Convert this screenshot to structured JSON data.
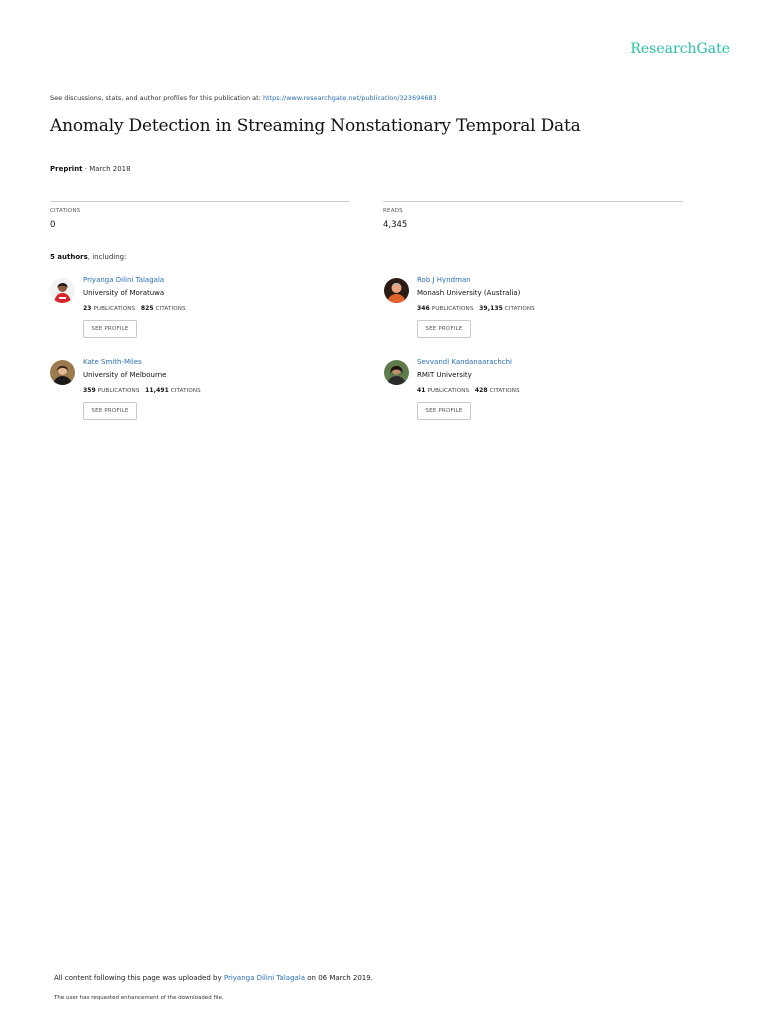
{
  "brand": "ResearchGate",
  "discussion": {
    "text": "See discussions, stats, and author profiles for this publication at: ",
    "url": "https://www.researchgate.net/publication/323694683"
  },
  "title": "Anomaly Detection in Streaming Nonstationary Temporal Data",
  "meta": {
    "type": "Preprint",
    "date": " · March 2018"
  },
  "stats": {
    "citations_label": "CITATIONS",
    "citations": "0",
    "reads_label": "READS",
    "reads": "4,345"
  },
  "authors_heading": {
    "count": "5 authors",
    "suffix": ", including:"
  },
  "authors": [
    {
      "name": "Priyanga Dilini Talagala",
      "institution": "University of Moratuwa",
      "publications": "23",
      "pub_label": "PUBLICATIONS",
      "citations": "825",
      "cit_label": "CITATIONS",
      "button": "SEE PROFILE"
    },
    {
      "name": "Rob J Hyndman",
      "institution": "Monash University (Australia)",
      "publications": "346",
      "pub_label": "PUBLICATIONS",
      "citations": "39,135",
      "cit_label": "CITATIONS",
      "button": "SEE PROFILE"
    },
    {
      "name": "Kate Smith-Miles",
      "institution": "University of Melbourne",
      "publications": "359",
      "pub_label": "PUBLICATIONS",
      "citations": "11,491",
      "cit_label": "CITATIONS",
      "button": "SEE PROFILE"
    },
    {
      "name": "Sevvandi Kandanaarachchi",
      "institution": "RMIT University",
      "publications": "41",
      "pub_label": "PUBLICATIONS",
      "citations": "428",
      "cit_label": "CITATIONS",
      "button": "SEE PROFILE"
    }
  ],
  "footer": {
    "prefix": "All content following this page was uploaded by ",
    "uploader": "Priyanga Dilini Talagala",
    "suffix": " on 06 March 2019.",
    "note": "The user has requested enhancement of the downloaded file."
  },
  "colors": {
    "brand": "#29c1a6",
    "link": "#2b6fb6"
  }
}
